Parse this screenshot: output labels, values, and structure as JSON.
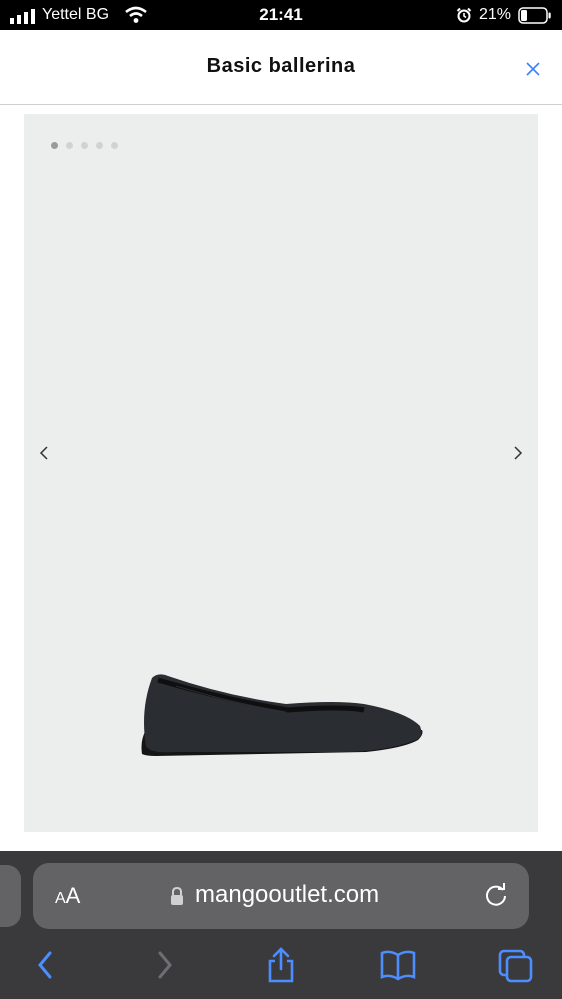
{
  "status_bar": {
    "carrier": "Yettel BG",
    "time": "21:41",
    "battery": "21%"
  },
  "header": {
    "title": "Basic ballerina"
  },
  "gallery": {
    "image_count": 5,
    "active_index": 0,
    "image_alt": "black ballerina flat shoe"
  },
  "browser": {
    "aa_label_small": "A",
    "aa_label_big": "A",
    "url": "mangooutlet.com"
  },
  "colors": {
    "accent": "#3b82f6",
    "safari_blue": "#4c8dff"
  },
  "icons": [
    "signal-icon",
    "wifi-icon",
    "alarm-icon",
    "battery-icon",
    "close-icon",
    "chevron-left-icon",
    "chevron-right-icon",
    "lock-icon",
    "reload-icon",
    "back-icon",
    "forward-icon",
    "share-icon",
    "bookmarks-icon",
    "tabs-icon"
  ]
}
